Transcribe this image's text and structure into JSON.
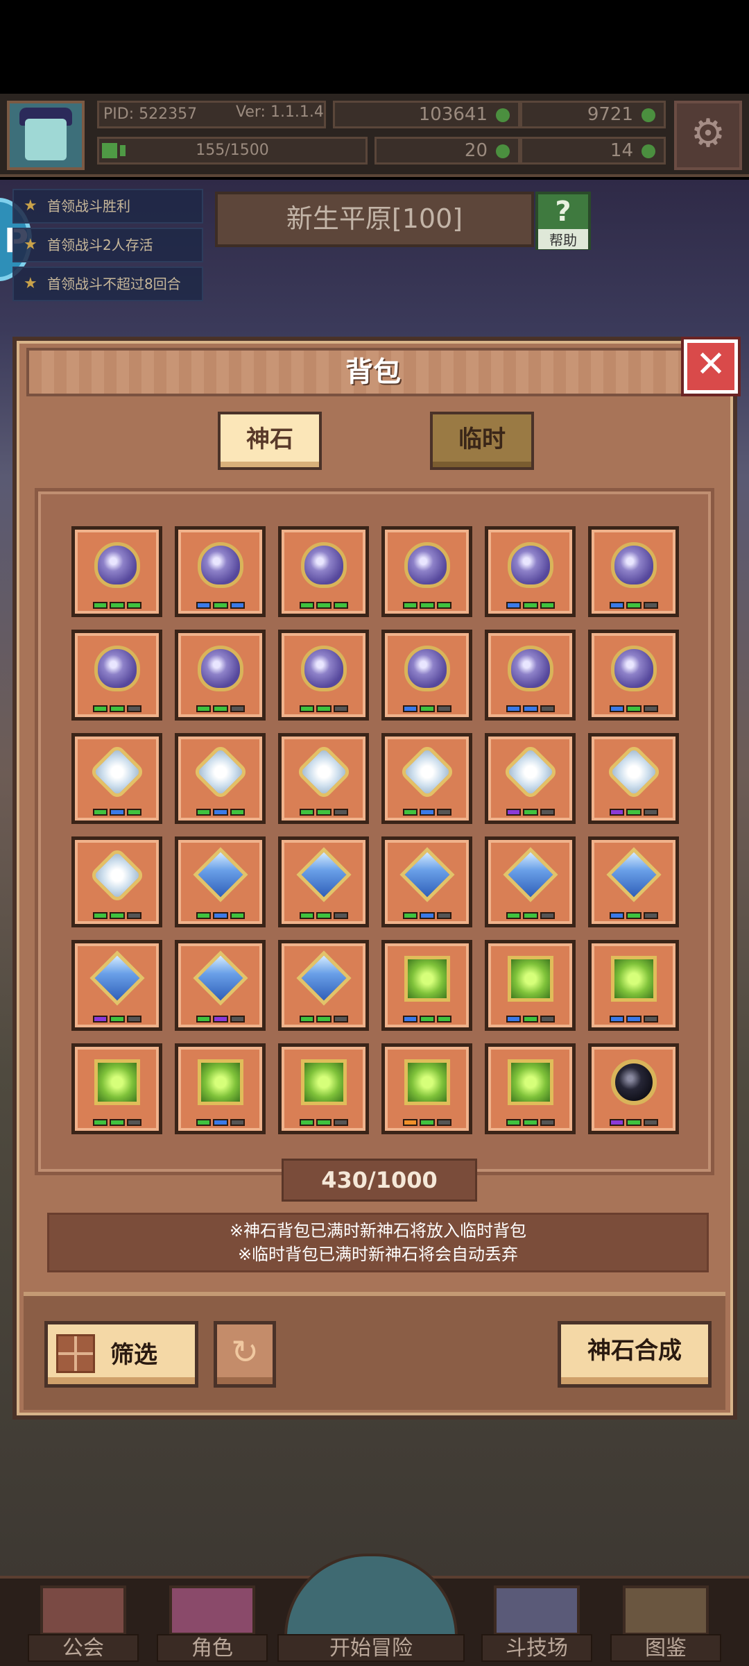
{
  "hud": {
    "pid": "PID: 522357",
    "version": "Ver: 1.1.1.4",
    "exp": "155/1500",
    "gold": "103641",
    "gems": "9721",
    "clover": "20",
    "hand": "14"
  },
  "quests": [
    "首领战斗胜利",
    "首领战斗2人存活",
    "首领战斗不超过8回合"
  ],
  "stage": {
    "name": "新生平原[100]",
    "help_label": "帮助",
    "help_icon": "?"
  },
  "bag": {
    "title": "背包",
    "close": "✕",
    "tabs": {
      "gods": "神石",
      "temp": "临时"
    },
    "capacity": "430/1000",
    "notice_1": "※神石背包已满时新神石将放入临时背包",
    "notice_2": "※临时背包已满时新神石将会自动丢弃",
    "filter_label": "筛选",
    "refresh_icon": "↻",
    "synth_label": "神石合成",
    "items": [
      {
        "type": "purple",
        "dots": [
          "g",
          "g",
          "g"
        ]
      },
      {
        "type": "purple",
        "dots": [
          "b",
          "g",
          "b"
        ]
      },
      {
        "type": "purple",
        "dots": [
          "g",
          "g",
          "g"
        ]
      },
      {
        "type": "purple",
        "dots": [
          "g",
          "g",
          "g"
        ]
      },
      {
        "type": "purple",
        "dots": [
          "b",
          "g",
          "g"
        ]
      },
      {
        "type": "purple",
        "dots": [
          "b",
          "g",
          "n"
        ]
      },
      {
        "type": "purple",
        "dots": [
          "g",
          "g",
          "n"
        ]
      },
      {
        "type": "purple",
        "dots": [
          "g",
          "g",
          "n"
        ]
      },
      {
        "type": "purple",
        "dots": [
          "g",
          "g",
          "n"
        ]
      },
      {
        "type": "purple",
        "dots": [
          "b",
          "g",
          "n"
        ]
      },
      {
        "type": "purple",
        "dots": [
          "b",
          "b",
          "n"
        ]
      },
      {
        "type": "purple",
        "dots": [
          "b",
          "g",
          "n"
        ]
      },
      {
        "type": "white",
        "dots": [
          "g",
          "b",
          "g"
        ]
      },
      {
        "type": "white",
        "dots": [
          "g",
          "b",
          "g"
        ]
      },
      {
        "type": "white",
        "dots": [
          "g",
          "g",
          "n"
        ]
      },
      {
        "type": "white",
        "dots": [
          "g",
          "b",
          "n"
        ]
      },
      {
        "type": "white",
        "dots": [
          "p",
          "g",
          "n"
        ]
      },
      {
        "type": "white",
        "dots": [
          "p",
          "g",
          "n"
        ]
      },
      {
        "type": "white",
        "dots": [
          "g",
          "g",
          "n"
        ]
      },
      {
        "type": "blue",
        "dots": [
          "g",
          "b",
          "g"
        ]
      },
      {
        "type": "blue",
        "dots": [
          "g",
          "g",
          "n"
        ]
      },
      {
        "type": "blue",
        "dots": [
          "g",
          "b",
          "n"
        ]
      },
      {
        "type": "blue",
        "dots": [
          "g",
          "g",
          "n"
        ]
      },
      {
        "type": "blue",
        "dots": [
          "b",
          "g",
          "n"
        ]
      },
      {
        "type": "blue",
        "dots": [
          "p",
          "g",
          "n"
        ]
      },
      {
        "type": "blue",
        "dots": [
          "g",
          "p",
          "n"
        ]
      },
      {
        "type": "blue",
        "dots": [
          "g",
          "g",
          "n"
        ]
      },
      {
        "type": "green",
        "dots": [
          "b",
          "g",
          "g"
        ]
      },
      {
        "type": "green",
        "dots": [
          "b",
          "g",
          "n"
        ]
      },
      {
        "type": "green",
        "dots": [
          "b",
          "b",
          "n"
        ]
      },
      {
        "type": "green",
        "dots": [
          "g",
          "g",
          "n"
        ]
      },
      {
        "type": "green",
        "dots": [
          "g",
          "b",
          "n"
        ]
      },
      {
        "type": "green",
        "dots": [
          "g",
          "g",
          "n"
        ]
      },
      {
        "type": "green",
        "dots": [
          "o",
          "g",
          "n"
        ]
      },
      {
        "type": "green",
        "dots": [
          "g",
          "g",
          "n"
        ]
      },
      {
        "type": "black",
        "dots": [
          "p",
          "g",
          "n"
        ]
      }
    ]
  },
  "nav": {
    "guild": "公会",
    "role": "角色",
    "start": "开始冒险",
    "arena": "斗技场",
    "book": "图鉴"
  }
}
